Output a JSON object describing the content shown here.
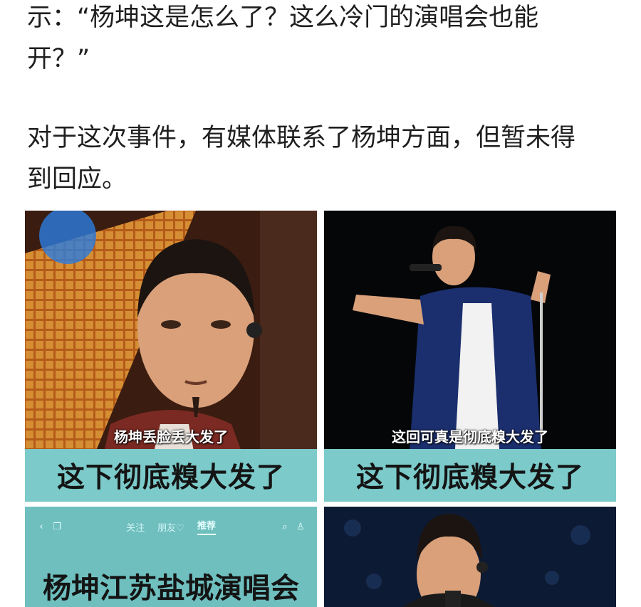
{
  "article": {
    "paragraphs": [
      {
        "line1": "示：“杨坤这是怎么了？这么冷门的演唱会也能",
        "line2": "开？”"
      },
      {
        "line1": "对于这次事件，有媒体联系了杨坤方面，但暂未得",
        "line2": "到回应。"
      }
    ]
  },
  "images": [
    {
      "subtitle": "杨坤丢脸丢大发了",
      "caption": "这下彻底糗大发了"
    },
    {
      "subtitle": "这回可真是彻底糗大发了",
      "caption": "这下彻底糗大发了"
    },
    {
      "appbar": {
        "tabs": [
          "关注",
          "朋友♡",
          "推荐"
        ],
        "active_tab": "推荐"
      },
      "title": "杨坤江苏盐城演唱会"
    },
    {}
  ]
}
